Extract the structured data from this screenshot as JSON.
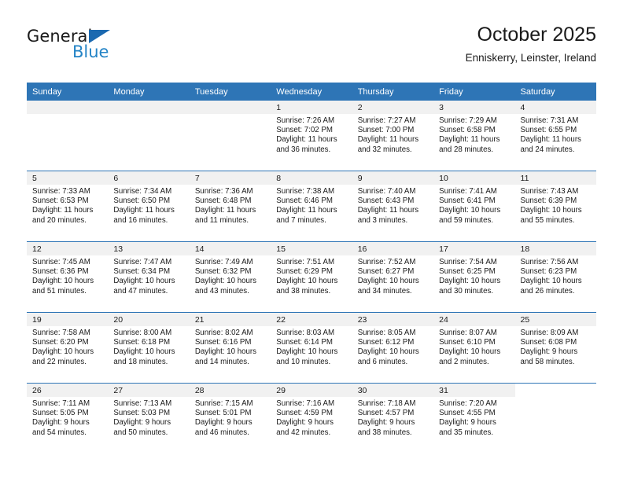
{
  "brand": {
    "name_top": "General",
    "name_bottom": "Blue",
    "accent_color": "#2484c6",
    "triangle_color": "#1b69b0"
  },
  "header": {
    "title": "October 2025",
    "subtitle": "Enniskerry, Leinster, Ireland"
  },
  "theme": {
    "header_row_bg": "#2e75b6",
    "day_band_bg": "#f1f1f1",
    "grid_line": "#2e75b6",
    "text": "#1a1a1a"
  },
  "weekday_headers": [
    "Sunday",
    "Monday",
    "Tuesday",
    "Wednesday",
    "Thursday",
    "Friday",
    "Saturday"
  ],
  "labels": {
    "sunrise_prefix": "Sunrise:",
    "sunset_prefix": "Sunset:",
    "daylight_prefix": "Daylight:"
  },
  "weeks": [
    [
      {
        "day": "",
        "sunrise": "",
        "sunset": "",
        "daylight_line1": "",
        "daylight_line2": "",
        "empty": true,
        "blank": false
      },
      {
        "day": "",
        "sunrise": "",
        "sunset": "",
        "daylight_line1": "",
        "daylight_line2": "",
        "empty": true,
        "blank": false
      },
      {
        "day": "",
        "sunrise": "",
        "sunset": "",
        "daylight_line1": "",
        "daylight_line2": "",
        "empty": true,
        "blank": false
      },
      {
        "day": "1",
        "sunrise": "Sunrise: 7:26 AM",
        "sunset": "Sunset: 7:02 PM",
        "daylight_line1": "Daylight: 11 hours",
        "daylight_line2": "and 36 minutes."
      },
      {
        "day": "2",
        "sunrise": "Sunrise: 7:27 AM",
        "sunset": "Sunset: 7:00 PM",
        "daylight_line1": "Daylight: 11 hours",
        "daylight_line2": "and 32 minutes."
      },
      {
        "day": "3",
        "sunrise": "Sunrise: 7:29 AM",
        "sunset": "Sunset: 6:58 PM",
        "daylight_line1": "Daylight: 11 hours",
        "daylight_line2": "and 28 minutes."
      },
      {
        "day": "4",
        "sunrise": "Sunrise: 7:31 AM",
        "sunset": "Sunset: 6:55 PM",
        "daylight_line1": "Daylight: 11 hours",
        "daylight_line2": "and 24 minutes."
      }
    ],
    [
      {
        "day": "5",
        "sunrise": "Sunrise: 7:33 AM",
        "sunset": "Sunset: 6:53 PM",
        "daylight_line1": "Daylight: 11 hours",
        "daylight_line2": "and 20 minutes."
      },
      {
        "day": "6",
        "sunrise": "Sunrise: 7:34 AM",
        "sunset": "Sunset: 6:50 PM",
        "daylight_line1": "Daylight: 11 hours",
        "daylight_line2": "and 16 minutes."
      },
      {
        "day": "7",
        "sunrise": "Sunrise: 7:36 AM",
        "sunset": "Sunset: 6:48 PM",
        "daylight_line1": "Daylight: 11 hours",
        "daylight_line2": "and 11 minutes."
      },
      {
        "day": "8",
        "sunrise": "Sunrise: 7:38 AM",
        "sunset": "Sunset: 6:46 PM",
        "daylight_line1": "Daylight: 11 hours",
        "daylight_line2": "and 7 minutes."
      },
      {
        "day": "9",
        "sunrise": "Sunrise: 7:40 AM",
        "sunset": "Sunset: 6:43 PM",
        "daylight_line1": "Daylight: 11 hours",
        "daylight_line2": "and 3 minutes."
      },
      {
        "day": "10",
        "sunrise": "Sunrise: 7:41 AM",
        "sunset": "Sunset: 6:41 PM",
        "daylight_line1": "Daylight: 10 hours",
        "daylight_line2": "and 59 minutes."
      },
      {
        "day": "11",
        "sunrise": "Sunrise: 7:43 AM",
        "sunset": "Sunset: 6:39 PM",
        "daylight_line1": "Daylight: 10 hours",
        "daylight_line2": "and 55 minutes."
      }
    ],
    [
      {
        "day": "12",
        "sunrise": "Sunrise: 7:45 AM",
        "sunset": "Sunset: 6:36 PM",
        "daylight_line1": "Daylight: 10 hours",
        "daylight_line2": "and 51 minutes."
      },
      {
        "day": "13",
        "sunrise": "Sunrise: 7:47 AM",
        "sunset": "Sunset: 6:34 PM",
        "daylight_line1": "Daylight: 10 hours",
        "daylight_line2": "and 47 minutes."
      },
      {
        "day": "14",
        "sunrise": "Sunrise: 7:49 AM",
        "sunset": "Sunset: 6:32 PM",
        "daylight_line1": "Daylight: 10 hours",
        "daylight_line2": "and 43 minutes."
      },
      {
        "day": "15",
        "sunrise": "Sunrise: 7:51 AM",
        "sunset": "Sunset: 6:29 PM",
        "daylight_line1": "Daylight: 10 hours",
        "daylight_line2": "and 38 minutes."
      },
      {
        "day": "16",
        "sunrise": "Sunrise: 7:52 AM",
        "sunset": "Sunset: 6:27 PM",
        "daylight_line1": "Daylight: 10 hours",
        "daylight_line2": "and 34 minutes."
      },
      {
        "day": "17",
        "sunrise": "Sunrise: 7:54 AM",
        "sunset": "Sunset: 6:25 PM",
        "daylight_line1": "Daylight: 10 hours",
        "daylight_line2": "and 30 minutes."
      },
      {
        "day": "18",
        "sunrise": "Sunrise: 7:56 AM",
        "sunset": "Sunset: 6:23 PM",
        "daylight_line1": "Daylight: 10 hours",
        "daylight_line2": "and 26 minutes."
      }
    ],
    [
      {
        "day": "19",
        "sunrise": "Sunrise: 7:58 AM",
        "sunset": "Sunset: 6:20 PM",
        "daylight_line1": "Daylight: 10 hours",
        "daylight_line2": "and 22 minutes."
      },
      {
        "day": "20",
        "sunrise": "Sunrise: 8:00 AM",
        "sunset": "Sunset: 6:18 PM",
        "daylight_line1": "Daylight: 10 hours",
        "daylight_line2": "and 18 minutes."
      },
      {
        "day": "21",
        "sunrise": "Sunrise: 8:02 AM",
        "sunset": "Sunset: 6:16 PM",
        "daylight_line1": "Daylight: 10 hours",
        "daylight_line2": "and 14 minutes."
      },
      {
        "day": "22",
        "sunrise": "Sunrise: 8:03 AM",
        "sunset": "Sunset: 6:14 PM",
        "daylight_line1": "Daylight: 10 hours",
        "daylight_line2": "and 10 minutes."
      },
      {
        "day": "23",
        "sunrise": "Sunrise: 8:05 AM",
        "sunset": "Sunset: 6:12 PM",
        "daylight_line1": "Daylight: 10 hours",
        "daylight_line2": "and 6 minutes."
      },
      {
        "day": "24",
        "sunrise": "Sunrise: 8:07 AM",
        "sunset": "Sunset: 6:10 PM",
        "daylight_line1": "Daylight: 10 hours",
        "daylight_line2": "and 2 minutes."
      },
      {
        "day": "25",
        "sunrise": "Sunrise: 8:09 AM",
        "sunset": "Sunset: 6:08 PM",
        "daylight_line1": "Daylight: 9 hours",
        "daylight_line2": "and 58 minutes."
      }
    ],
    [
      {
        "day": "26",
        "sunrise": "Sunrise: 7:11 AM",
        "sunset": "Sunset: 5:05 PM",
        "daylight_line1": "Daylight: 9 hours",
        "daylight_line2": "and 54 minutes."
      },
      {
        "day": "27",
        "sunrise": "Sunrise: 7:13 AM",
        "sunset": "Sunset: 5:03 PM",
        "daylight_line1": "Daylight: 9 hours",
        "daylight_line2": "and 50 minutes."
      },
      {
        "day": "28",
        "sunrise": "Sunrise: 7:15 AM",
        "sunset": "Sunset: 5:01 PM",
        "daylight_line1": "Daylight: 9 hours",
        "daylight_line2": "and 46 minutes."
      },
      {
        "day": "29",
        "sunrise": "Sunrise: 7:16 AM",
        "sunset": "Sunset: 4:59 PM",
        "daylight_line1": "Daylight: 9 hours",
        "daylight_line2": "and 42 minutes."
      },
      {
        "day": "30",
        "sunrise": "Sunrise: 7:18 AM",
        "sunset": "Sunset: 4:57 PM",
        "daylight_line1": "Daylight: 9 hours",
        "daylight_line2": "and 38 minutes."
      },
      {
        "day": "31",
        "sunrise": "Sunrise: 7:20 AM",
        "sunset": "Sunset: 4:55 PM",
        "daylight_line1": "Daylight: 9 hours",
        "daylight_line2": "and 35 minutes."
      },
      {
        "day": "",
        "sunrise": "",
        "sunset": "",
        "daylight_line1": "",
        "daylight_line2": "",
        "empty": true,
        "blank": true
      }
    ]
  ]
}
